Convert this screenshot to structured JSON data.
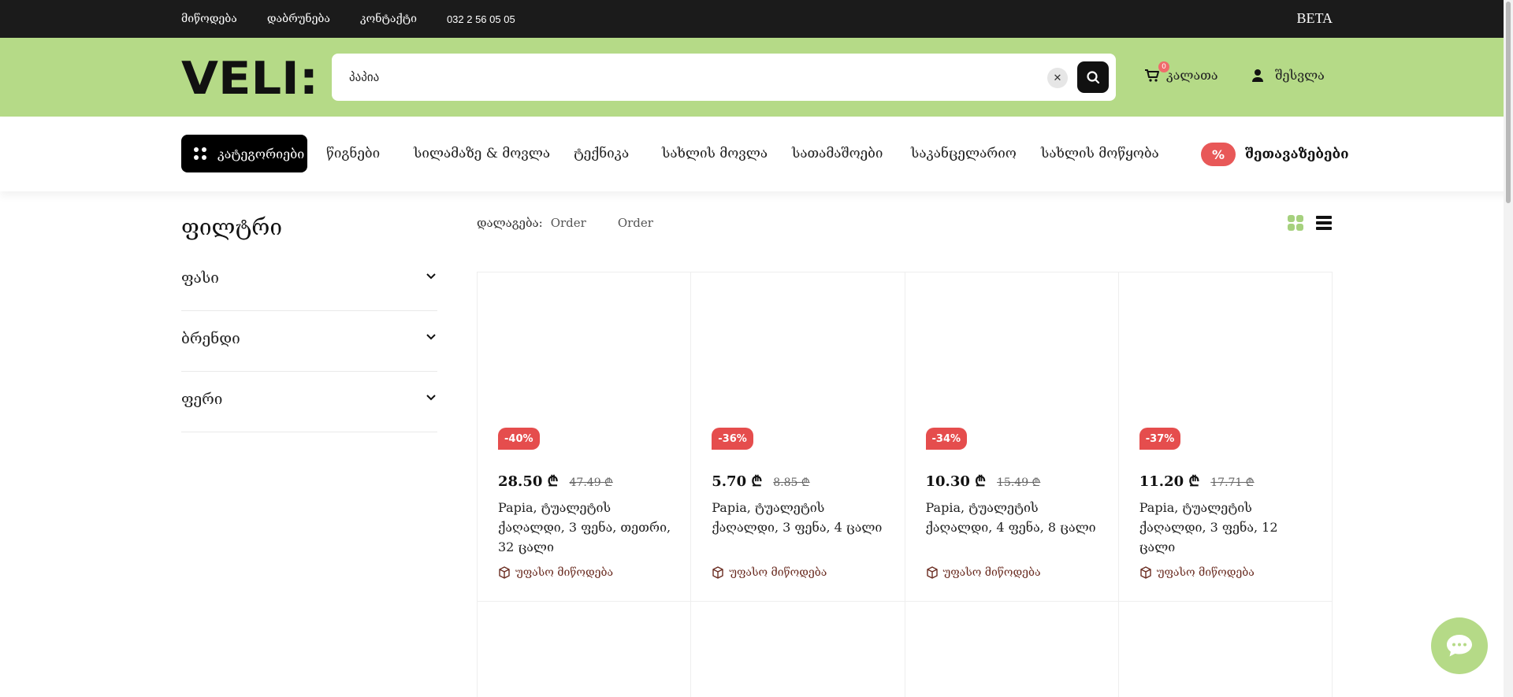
{
  "topbar": {
    "links": [
      "მიწოდება",
      "დაბრუნება",
      "კონტაქტი",
      "032 2 56 05 05"
    ],
    "beta": "BETA"
  },
  "header": {
    "logo": "VELI:",
    "search_value": "პაპია",
    "cart_label": "კალათა",
    "cart_count": "0",
    "login_label": "შესვლა"
  },
  "nav": {
    "categories_label": "კატეგორიები",
    "items": [
      "წიგნები",
      "სილამაზე & მოვლა",
      "ტექნიკა",
      "სახლის მოვლა",
      "სათამაშოები",
      "საკანცელარიო",
      "სახლის მოწყობა"
    ],
    "promo_badge": "%",
    "promo_label": "შეთავაზებები"
  },
  "filters": {
    "title": "ფილტრი",
    "groups": [
      "ფასი",
      "ბრენდი",
      "ფერი"
    ]
  },
  "sort": {
    "label": "დალაგება:",
    "options": [
      "Order",
      "Order"
    ]
  },
  "products": [
    {
      "discount": "-40%",
      "price": "28.50 ₾",
      "old_price": "47.49 ₾",
      "name": "Papia, ტუალეტის ქაღალდი, 3 ფენა, თეთრი, 32 ცალი",
      "shipping": "უფასო მიწოდება"
    },
    {
      "discount": "-36%",
      "price": "5.70 ₾",
      "old_price": "8.85 ₾",
      "name": "Papia, ტუალეტის ქაღალდი, 3 ფენა, 4 ცალი",
      "shipping": "უფასო მიწოდება"
    },
    {
      "discount": "-34%",
      "price": "10.30 ₾",
      "old_price": "15.49 ₾",
      "name": "Papia, ტუალეტის ქაღალდი, 4 ფენა, 8 ცალი",
      "shipping": "უფასო მიწოდება"
    },
    {
      "discount": "-37%",
      "price": "11.20 ₾",
      "old_price": "17.71 ₾",
      "name": "Papia, ტუალეტის ქაღალდი, 3 ფენა, 12 ცალი",
      "shipping": "უფასო მიწოდება"
    }
  ],
  "icons": {
    "search": "search-icon",
    "clear": "close-icon",
    "cart": "cart-icon",
    "user": "user-icon",
    "chevron": "chevron-down-icon",
    "box": "box-icon",
    "chat": "chat-icon"
  },
  "colors": {
    "header_bg": "#b5da87",
    "topbar_bg": "#1b1b1b",
    "discount_badge": "#e54d4d",
    "promo_badge": "#e85858",
    "shipping_text": "#6b2d22",
    "grid_view_active": "#a6d17e"
  }
}
